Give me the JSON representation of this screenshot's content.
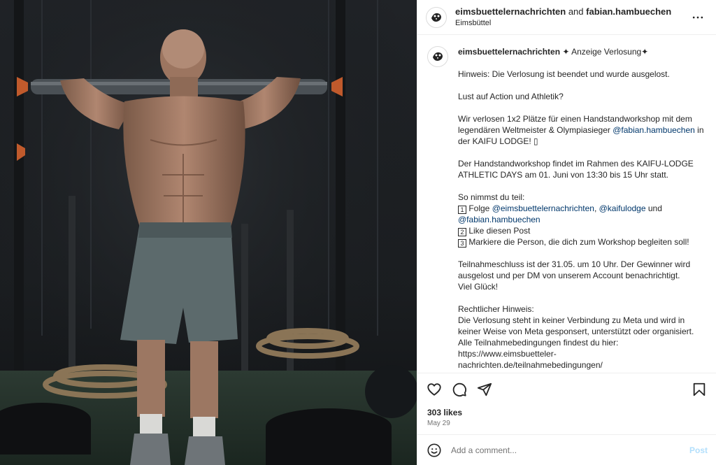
{
  "header": {
    "user1": "eimsbuettelernachrichten",
    "and": " and ",
    "user2": "fabian.hambuechen",
    "location": "Eimsbüttel"
  },
  "caption": {
    "username": "eimsbuettelernachrichten",
    "title": " ✦ Anzeige Verlosung✦",
    "notice": "Hinweis: Die Verlosung ist beendet und wurde ausgelost.",
    "hook": "Lust auf Action und Athletik?",
    "intro_1": "Wir verlosen 1x2 Plätze für einen Handstandworkshop mit dem legendären Weltmeister & Olympiasieger ",
    "intro_mention": "@fabian.hambuechen",
    "intro_2": " in der KAIFU LODGE! ▯",
    "details": "Der Handstandworkshop findet im Rahmen des KAIFU-LODGE ATHLETIC DAYS am 01. Juni von 13:30 bis 15 Uhr statt.",
    "how_title": "So nimmst du teil:",
    "step1_num": "1",
    "step1_text": " Folge ",
    "step1_m1": "@eimsbuettelernachrichten",
    "step1_sep": ", ",
    "step1_m2": "@kaifulodge",
    "step1_and": " und",
    "step1_m3": "@fabian.hambuechen",
    "step2_num": "2",
    "step2_text": " Like diesen Post",
    "step3_num": "3",
    "step3_text": " Markiere die Person, die dich zum Workshop begleiten soll!",
    "deadline": "Teilnahmeschluss ist der 31.05. um 10 Uhr. Der Gewinner wird ausgelost und per DM von unserem Account benachrichtigt.",
    "luck": "Viel Glück!",
    "legal_title": "Rechtlicher Hinweis:",
    "legal_body": "Die Verlosung steht in keiner Verbindung zu Meta und wird in keiner Weise von Meta gesponsert, unterstützt oder organisiert.",
    "legal_terms": "Alle Teilnahmebedingungen findest du hier:",
    "legal_url_1": "https://www.eimsbuetteler-",
    "legal_url_2": "nachrichten.de/teilnahmebedingungen/"
  },
  "engagement": {
    "likes": "303 likes",
    "date": "May 29"
  },
  "comment": {
    "placeholder": "Add a comment...",
    "post_label": "Post"
  },
  "icons": {
    "more": "more-horizontal-icon",
    "like": "heart-icon",
    "comment": "comment-icon",
    "share": "paper-plane-icon",
    "save": "bookmark-icon",
    "emoji": "smiley-icon"
  },
  "colors": {
    "mention": "#00376b",
    "post_disabled": "#b2dffc",
    "muted": "#737373"
  }
}
